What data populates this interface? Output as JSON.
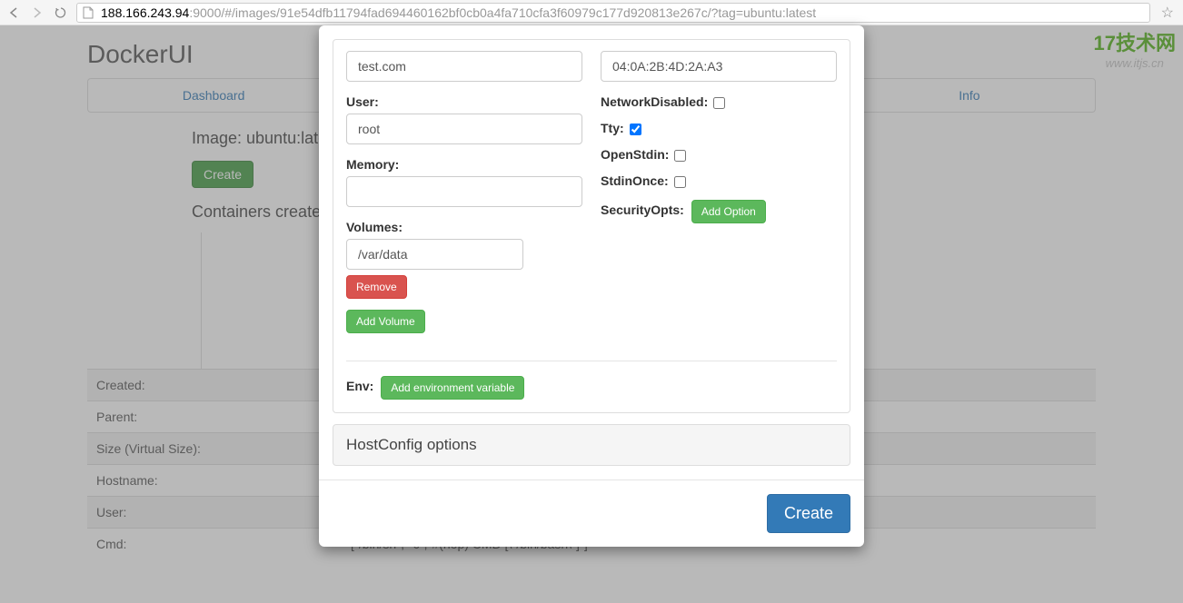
{
  "browser": {
    "url_host": "188.166.243.94",
    "url_path": ":9000/#/images/91e54dfb11794fad694460162bf0cb0a4fa710cfa3f60979c177d920813e267c/?tag=ubuntu:latest"
  },
  "watermark": {
    "logo_text": "17技术网",
    "url": "www.itjs.cn"
  },
  "header": {
    "brand": "DockerUI",
    "tabs": [
      "Dashboard",
      "",
      "",
      "Info"
    ]
  },
  "page": {
    "image_title": "Image: ubuntu:lates",
    "create_btn": "Create",
    "containers_label": "Containers created:",
    "table": [
      {
        "label": "Created:",
        "value": ""
      },
      {
        "label": "Parent:",
        "value": ""
      },
      {
        "label": "Size (Virtual Size):",
        "value": ""
      },
      {
        "label": "Hostname:",
        "value": ""
      },
      {
        "label": "User:",
        "value": ""
      },
      {
        "label": "Cmd:",
        "value": "[\"/bin/sh\",\"-c\",\"#(nop) CMD [\\\"/bin/bash\\\"]\"]"
      }
    ]
  },
  "modal": {
    "left": {
      "field1_value": "test.com",
      "user_label": "User:",
      "user_value": "root",
      "memory_label": "Memory:",
      "memory_value": "",
      "volumes_label": "Volumes:",
      "volume_value": "/var/data",
      "remove_btn": "Remove",
      "add_volume_btn": "Add Volume"
    },
    "right": {
      "mac_value": "04:0A:2B:4D:2A:A3",
      "network_disabled_label": "NetworkDisabled:",
      "network_disabled": false,
      "tty_label": "Tty:",
      "tty": true,
      "openstdin_label": "OpenStdin:",
      "openstdin": false,
      "stdinonce_label": "StdinOnce:",
      "stdinonce": false,
      "securityopts_label": "SecurityOpts:",
      "add_option_btn": "Add Option"
    },
    "env_label": "Env:",
    "add_env_btn": "Add environment variable",
    "hostconfig_label": "HostConfig options",
    "create_btn": "Create"
  }
}
